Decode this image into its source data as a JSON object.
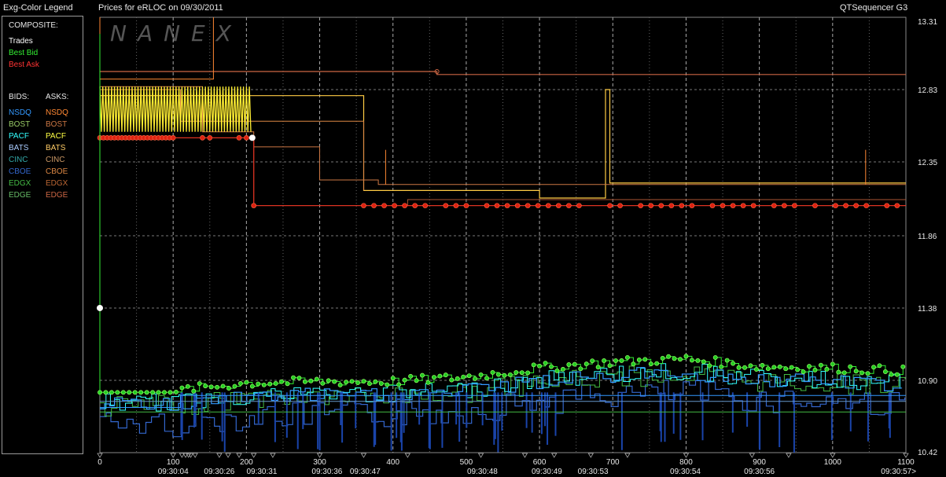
{
  "header": {
    "legend_title": "Exg-Color Legend",
    "chart_title": "Prices for  eRLOC  on  09/30/2011",
    "app_name": "QTSequencer G3",
    "watermark": "NANEX"
  },
  "legend": {
    "composite_label": "COMPOSITE:",
    "composite": [
      {
        "label": "Trades",
        "color": "#ffffff"
      },
      {
        "label": "Best Bid",
        "color": "#33ee33"
      },
      {
        "label": "Best Ask",
        "color": "#ff3333"
      }
    ],
    "bids_label": "BIDS:",
    "asks_label": "ASKS:",
    "bids": [
      {
        "label": "NSDQ",
        "color": "#3399ff"
      },
      {
        "label": "BOST",
        "color": "#99cc66"
      },
      {
        "label": "PACF",
        "color": "#33ffff"
      },
      {
        "label": "BATS",
        "color": "#aaccff"
      },
      {
        "label": "CINC",
        "color": "#33aaaa"
      },
      {
        "label": "CBOE",
        "color": "#3366cc"
      },
      {
        "label": "EDGX",
        "color": "#44bb44"
      },
      {
        "label": "EDGE",
        "color": "#66bb66"
      }
    ],
    "asks": [
      {
        "label": "NSDQ",
        "color": "#ff8833"
      },
      {
        "label": "BOST",
        "color": "#cc7744"
      },
      {
        "label": "PACF",
        "color": "#ffff44"
      },
      {
        "label": "BATS",
        "color": "#ffcc66"
      },
      {
        "label": "CINC",
        "color": "#cc9966"
      },
      {
        "label": "CBOE",
        "color": "#dd8844"
      },
      {
        "label": "EDGX",
        "color": "#bb6633"
      },
      {
        "label": "EDGE",
        "color": "#cc6644"
      }
    ]
  },
  "chart_data": {
    "type": "line",
    "title": "Prices for  eRLOC  on  09/30/2011",
    "xlim": [
      0,
      1100
    ],
    "ylim": [
      10.42,
      13.31
    ],
    "x_ticks": [
      0,
      100,
      200,
      300,
      400,
      500,
      600,
      700,
      800,
      900,
      1000,
      1100
    ],
    "time_labels": [
      {
        "x": 100,
        "label": "09:30:04"
      },
      {
        "x": 163,
        "label": "09:30:26"
      },
      {
        "x": 221,
        "label": "09:30:31"
      },
      {
        "x": 310,
        "label": "09:30:36"
      },
      {
        "x": 362,
        "label": "09:30:47"
      },
      {
        "x": 522,
        "label": "09:30:48"
      },
      {
        "x": 610,
        "label": "09:30:49"
      },
      {
        "x": 673,
        "label": "09:30:53"
      },
      {
        "x": 799,
        "label": "09:30:54"
      },
      {
        "x": 900,
        "label": "09:30:56"
      },
      {
        "x": 1090,
        "label": "09:30:57>"
      }
    ],
    "y_ticks": [
      13.31,
      12.83,
      12.35,
      11.86,
      11.38,
      10.9,
      10.42
    ],
    "y_tick_labels": [
      "13.31",
      "12.83",
      "12.35",
      "11.86",
      "11.38",
      "10.90",
      "10.42"
    ],
    "grid": true,
    "best_ask": [
      [
        0,
        12.51
      ],
      [
        210,
        12.51
      ],
      [
        210,
        12.06
      ],
      [
        1100,
        12.06
      ]
    ],
    "best_bid": [
      [
        0,
        10.82
      ],
      [
        100,
        10.82
      ],
      [
        200,
        10.87
      ],
      [
        300,
        10.88
      ],
      [
        400,
        10.88
      ],
      [
        500,
        10.91
      ],
      [
        600,
        10.97
      ],
      [
        700,
        11.01
      ],
      [
        800,
        11.03
      ],
      [
        900,
        10.98
      ],
      [
        1000,
        10.97
      ],
      [
        1100,
        10.95
      ]
    ],
    "trades": [
      [
        0,
        11.38
      ],
      [
        208,
        12.51
      ]
    ],
    "bats_ask": [
      [
        0,
        12.79
      ],
      [
        360,
        12.79
      ],
      [
        360,
        12.16
      ],
      [
        600,
        12.16
      ],
      [
        600,
        12.11
      ],
      [
        690,
        12.11
      ],
      [
        690,
        12.83
      ],
      [
        696,
        12.83
      ],
      [
        696,
        12.21
      ],
      [
        1100,
        12.21
      ]
    ],
    "nsdq_ask_top": [
      [
        0,
        12.95
      ],
      [
        460,
        12.95
      ],
      [
        460,
        12.93
      ],
      [
        1100,
        12.93
      ]
    ]
  }
}
